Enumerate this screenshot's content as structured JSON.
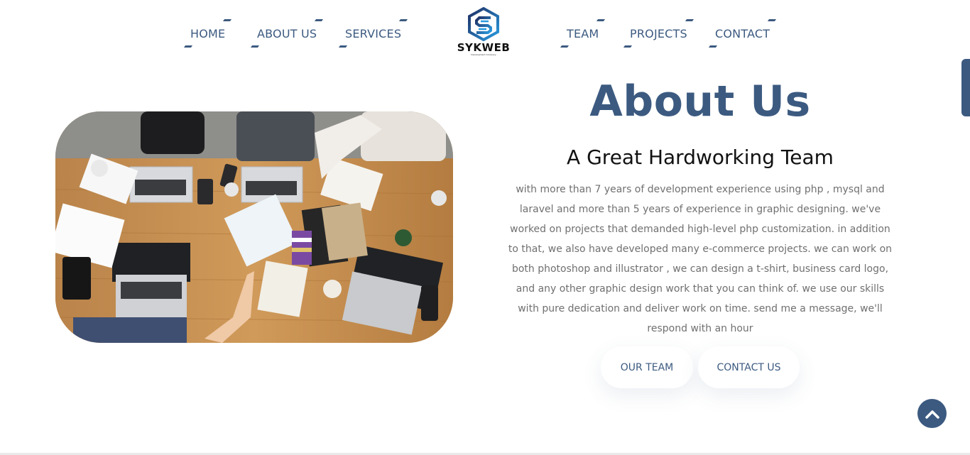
{
  "nav": {
    "left": [
      {
        "label": "HOME"
      },
      {
        "label": "ABOUT US"
      },
      {
        "label": "SERVICES"
      }
    ],
    "right": [
      {
        "label": "TEAM"
      },
      {
        "label": "PROJECTS"
      },
      {
        "label": "CONTACT"
      }
    ]
  },
  "logo": {
    "name": "SYKWEB",
    "tagline": "Development Company",
    "icon": "s-hexagon-logo-icon"
  },
  "about": {
    "title": "About Us",
    "subtitle": "A Great Hardworking Team",
    "description": "with more than 7 years of development experience using php , mysql and laravel and more than 5 years of experience in graphic designing. we've worked on projects that demanded high-level php customization. in addition to that, we also have developed many e-commerce projects. we can work on both photoshop and illustrator , we can design a t-shirt, business card logo, and any other graphic design work that you can think of. we use our skills with pure dedication and deliver work on time. send me a message, we'll respond with an hour",
    "buttons": {
      "team": "OUR TEAM",
      "contact": "CONTACT US"
    }
  },
  "icons": {
    "scroll_top": "chevron-up-icon",
    "photo": "team-desk-photo"
  },
  "colors": {
    "accent": "#3c5a80",
    "text_muted": "#707070",
    "heading": "#111111"
  }
}
